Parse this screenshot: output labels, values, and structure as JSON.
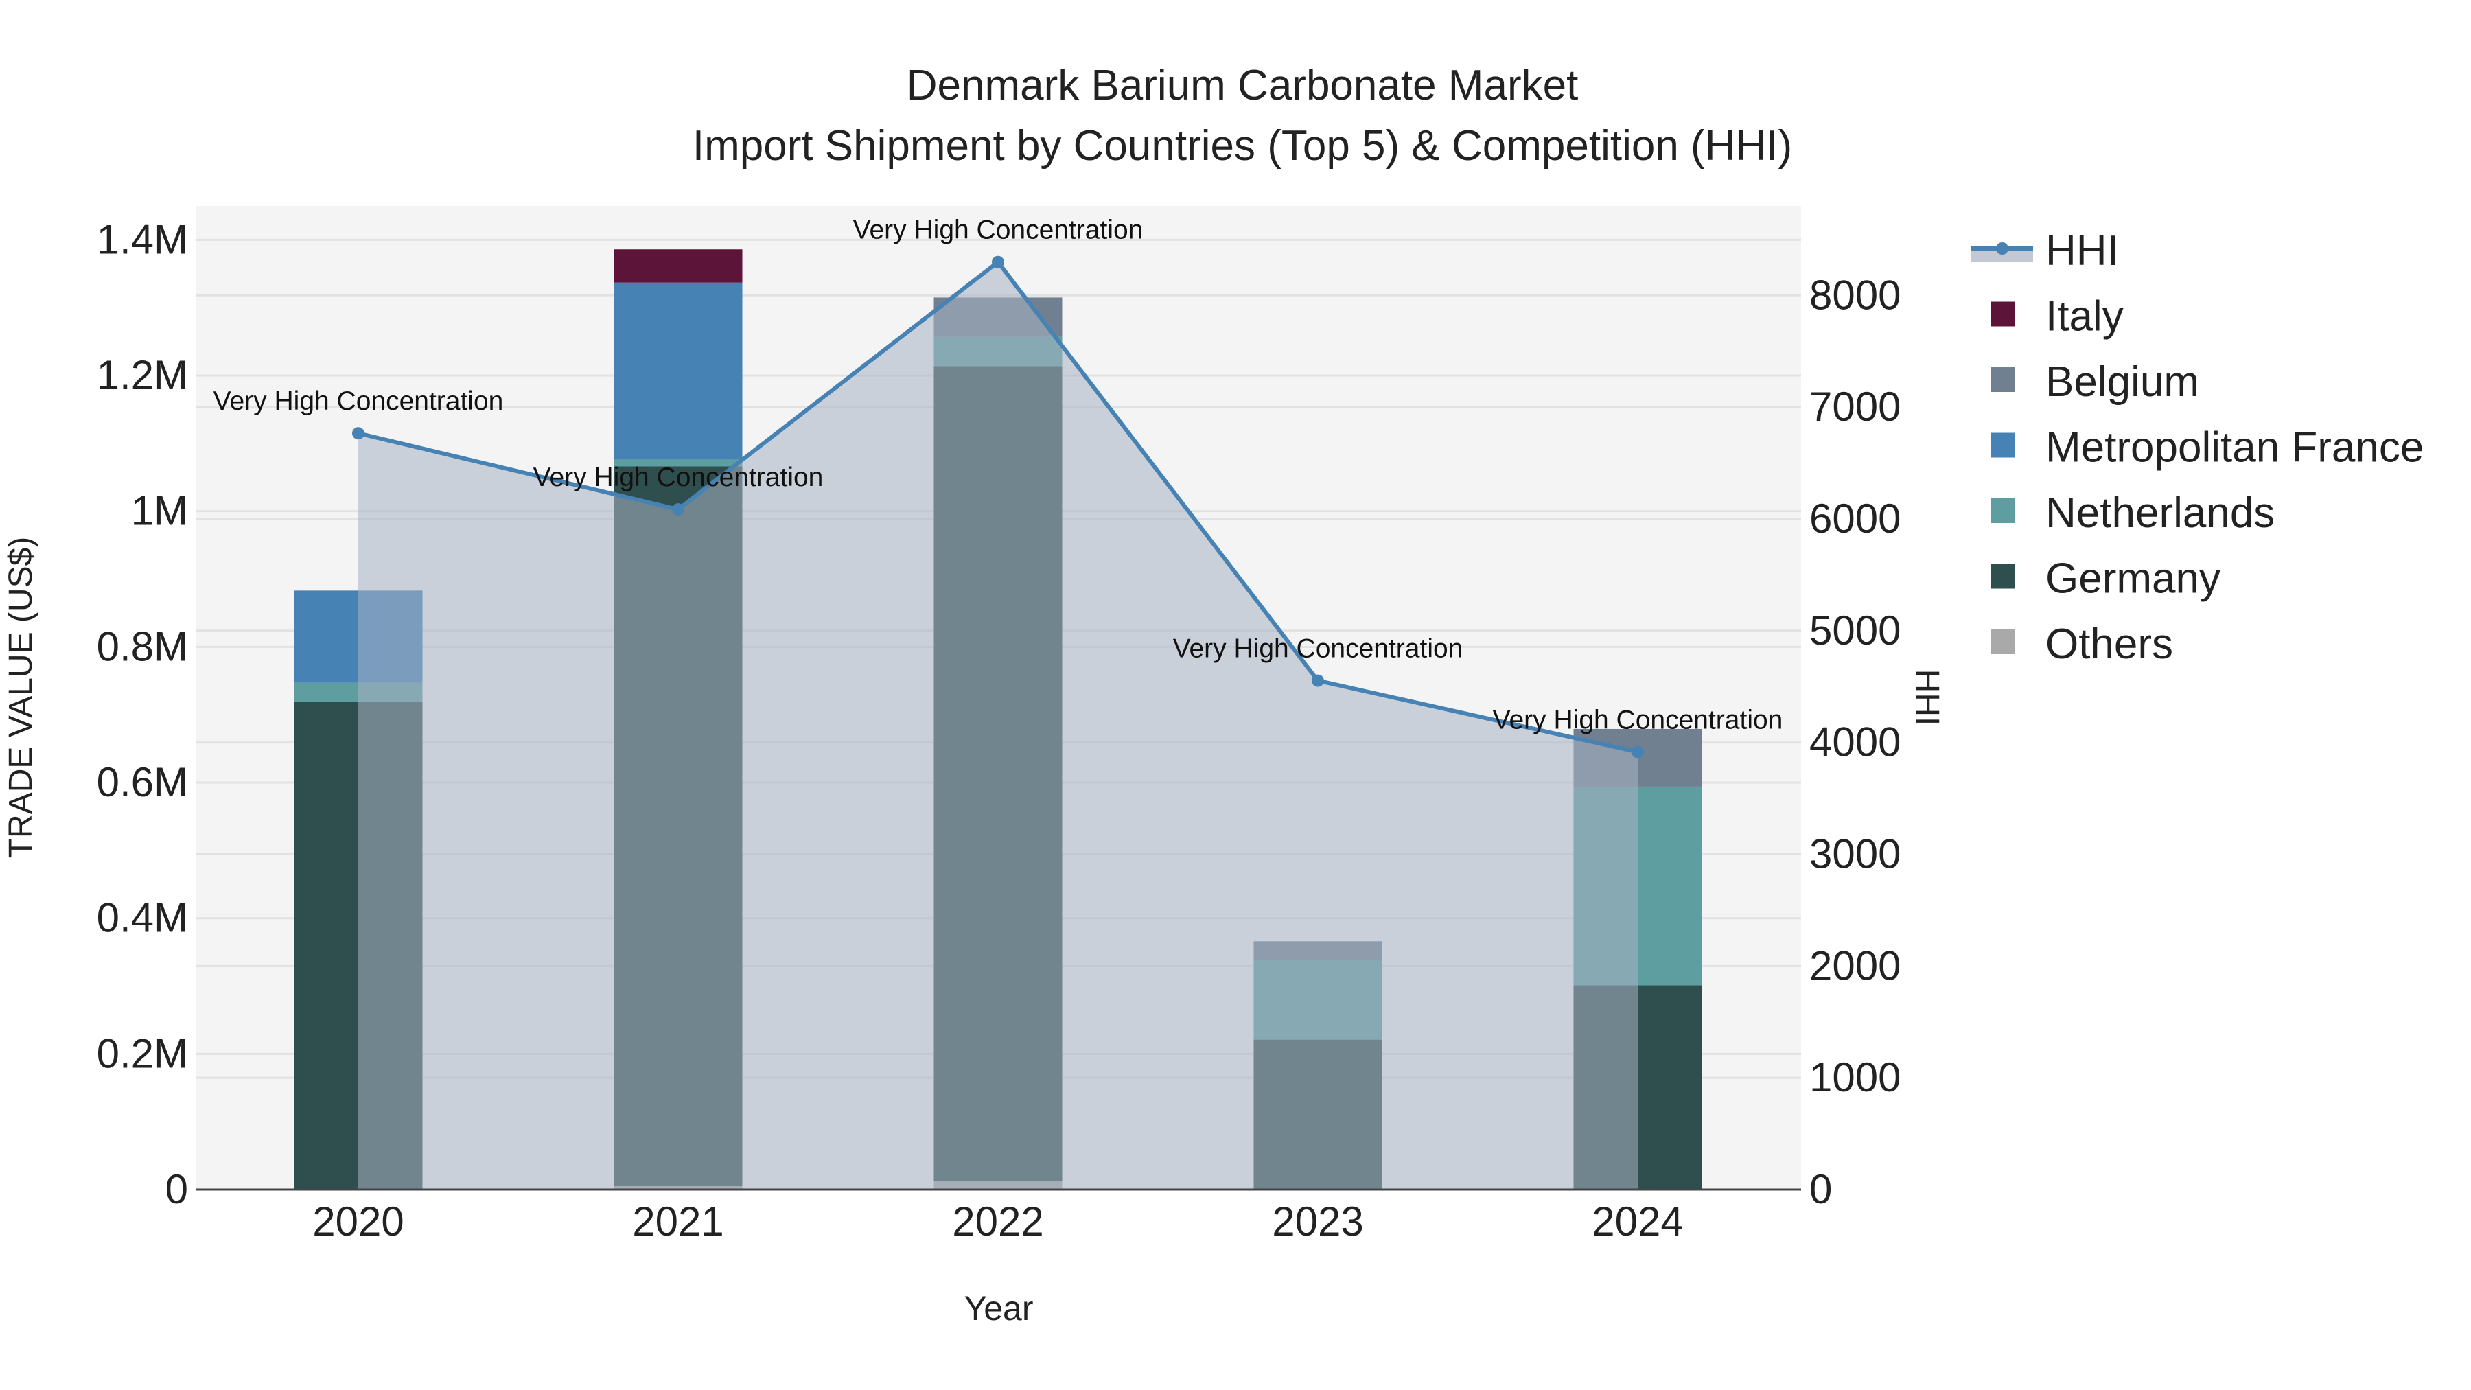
{
  "chart_data": {
    "type": "bar",
    "title": "Denmark Barium Carbonate Market",
    "subtitle": "Import Shipment by Countries (Top 5) & Competition (HHI)",
    "xlabel": "Year",
    "ylabel": "TRADE VALUE (US$)",
    "y2label": "HHI",
    "categories": [
      "2020",
      "2021",
      "2022",
      "2023",
      "2024"
    ],
    "ylim": [
      0,
      1450000
    ],
    "y2lim": [
      0,
      8800
    ],
    "yticks": [
      0,
      200000,
      400000,
      600000,
      800000,
      1000000,
      1200000,
      1400000
    ],
    "ytick_labels": [
      "0",
      "0.2M",
      "0.4M",
      "0.6M",
      "0.8M",
      "1M",
      "1.2M",
      "1.4M"
    ],
    "y2ticks": [
      0,
      1000,
      2000,
      3000,
      4000,
      5000,
      6000,
      7000,
      8000
    ],
    "y2tick_labels": [
      "0",
      "1000",
      "2000",
      "3000",
      "4000",
      "5000",
      "6000",
      "7000",
      "8000"
    ],
    "stacked": true,
    "series": [
      {
        "name": "Others",
        "color": "#a9a9a9",
        "values": [
          0,
          5000,
          12000,
          0,
          0
        ]
      },
      {
        "name": "Germany",
        "color": "#2f4f4f",
        "values": [
          719000,
          1061000,
          1202000,
          221000,
          301000
        ]
      },
      {
        "name": "Netherlands",
        "color": "#5f9ea0",
        "values": [
          28000,
          10000,
          43000,
          117000,
          293000
        ]
      },
      {
        "name": "Metropolitan France",
        "color": "#4682b4",
        "values": [
          136000,
          261000,
          0,
          0,
          0
        ]
      },
      {
        "name": "Belgium",
        "color": "#708090",
        "values": [
          0,
          0,
          58000,
          28000,
          85000
        ]
      },
      {
        "name": "Italy",
        "color": "#5c1538",
        "values": [
          0,
          49000,
          0,
          0,
          0
        ]
      }
    ],
    "line": {
      "name": "HHI",
      "color": "#4682b4",
      "values": [
        6766,
        6085,
        8298,
        4553,
        3915
      ],
      "annotations": [
        "Very High Concentration",
        "Very High Concentration",
        "Very High Concentration",
        "Very High Concentration",
        "Very High Concentration"
      ]
    },
    "legend": {
      "placement": "right",
      "entries": [
        "HHI",
        "Italy",
        "Belgium",
        "Metropolitan France",
        "Netherlands",
        "Germany",
        "Others"
      ]
    },
    "grid": true
  }
}
